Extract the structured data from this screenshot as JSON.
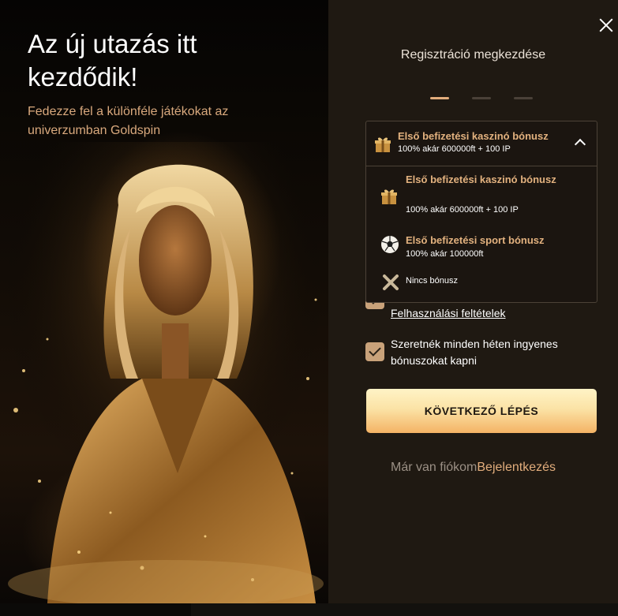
{
  "hero": {
    "title": "Az új utazás itt kezdődik!",
    "subtitle": "Fedezze fel a különféle játékokat az univerzumban Goldspin"
  },
  "registration": {
    "step_title": "Regisztráció megkezdése",
    "steps_total": 3,
    "active_step": 1,
    "bonus_dropdown": {
      "selected": {
        "title": "Első befizetési kaszinó bónusz",
        "subtitle": "100% akár 600000ft + 100 IP",
        "icon": "gift-icon"
      },
      "options": [
        {
          "title": "Első befizetési kaszinó bónusz",
          "subtitle": "100% akár 600000ft + 100 IP",
          "icon": "gift-icon"
        },
        {
          "title": "Első befizetési sport bónusz",
          "subtitle": "100% akár 100000ft",
          "icon": "soccer-ball-icon"
        },
        {
          "title": "Nincs bónusz",
          "icon": "cross-icon"
        }
      ]
    },
    "terms_link": "Felhasználási feltételek",
    "weekly_bonus_text": "Szeretnék minden héten ingyenes bónuszokat kapni",
    "next_button": "KÖVETKEZŐ LÉPÉS",
    "have_account_text": "Már van fiókom",
    "login_link": "Bejelentkezés"
  },
  "colors": {
    "accent": "#e2ad7c",
    "panel_bg": "#1f1912",
    "button_top": "#fff3c6",
    "button_bottom": "#f4b365"
  }
}
